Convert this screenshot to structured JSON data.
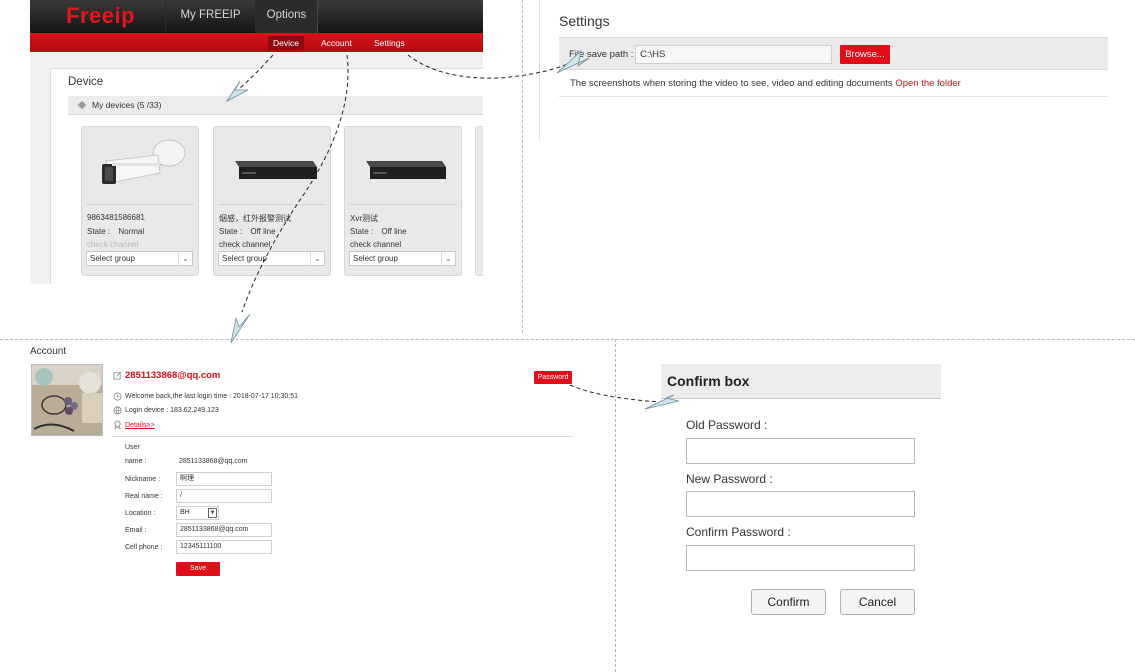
{
  "device_page": {
    "logo": "Freeip",
    "topnav": [
      {
        "label": "My FREEIP"
      },
      {
        "label": "Options"
      }
    ],
    "subnav": [
      {
        "label": "Device"
      },
      {
        "label": "Account"
      },
      {
        "label": "Settings"
      }
    ],
    "section_title": "Device",
    "devices_header": "My devices (5 /33)",
    "cards": [
      {
        "name": "9863481586681",
        "state_label": "State :",
        "state_value": "Normal",
        "check": "check channel",
        "group": "Select group"
      },
      {
        "name": "烟感，红外报警测试",
        "state_label": "State :",
        "state_value": "Off line",
        "check": "check channel",
        "group": "Select group"
      },
      {
        "name": "Xvr测试",
        "state_label": "State :",
        "state_value": "Off line",
        "check": "check channel",
        "group": "Select group"
      }
    ]
  },
  "settings": {
    "title": "Settings",
    "save_path_label": "File save path :",
    "save_path_value": "C:\\HS",
    "browse_label": "Browse...",
    "note": "The screenshots when storing the video to see, video and editing documents",
    "open_folder": "Open the folder"
  },
  "account": {
    "title": "Account",
    "email": "2851133868@qq.com",
    "password_button": "Password",
    "welcome": "Welcome back,the last login time : 2018-07-17 10:30:51",
    "login_device": "Login device : 183.62.249.123",
    "details_link": "Details>>",
    "user_label_1": "User",
    "user_label_2": "name :",
    "user_name": "2851133868@qq.com",
    "nickname_label": "Nickname :",
    "nickname": "啊理",
    "realname_label": "Real name :",
    "realname": "/",
    "location_label": "Location :",
    "location": "BH",
    "email_label": "Email :",
    "email_value": "2851133868@qq.com",
    "phone_label": "Cell phone :",
    "phone": "12345111100",
    "save_button": "Save"
  },
  "confirm_box": {
    "title": "Confirm box",
    "old_label": "Old Password :",
    "new_label": "New Password :",
    "confirm_label": "Confirm Password :",
    "confirm_button": "Confirm",
    "cancel_button": "Cancel"
  },
  "colors": {
    "brand_red": "#e10d1b",
    "nav_dark": "#1c1c1c",
    "panel_gray": "#ececec"
  },
  "icons": [
    "edit-icon",
    "clock-icon",
    "globe-icon",
    "badge-icon",
    "diamond-icon",
    "chevron-down-icon",
    "camera-icon",
    "dvr-icon"
  ]
}
